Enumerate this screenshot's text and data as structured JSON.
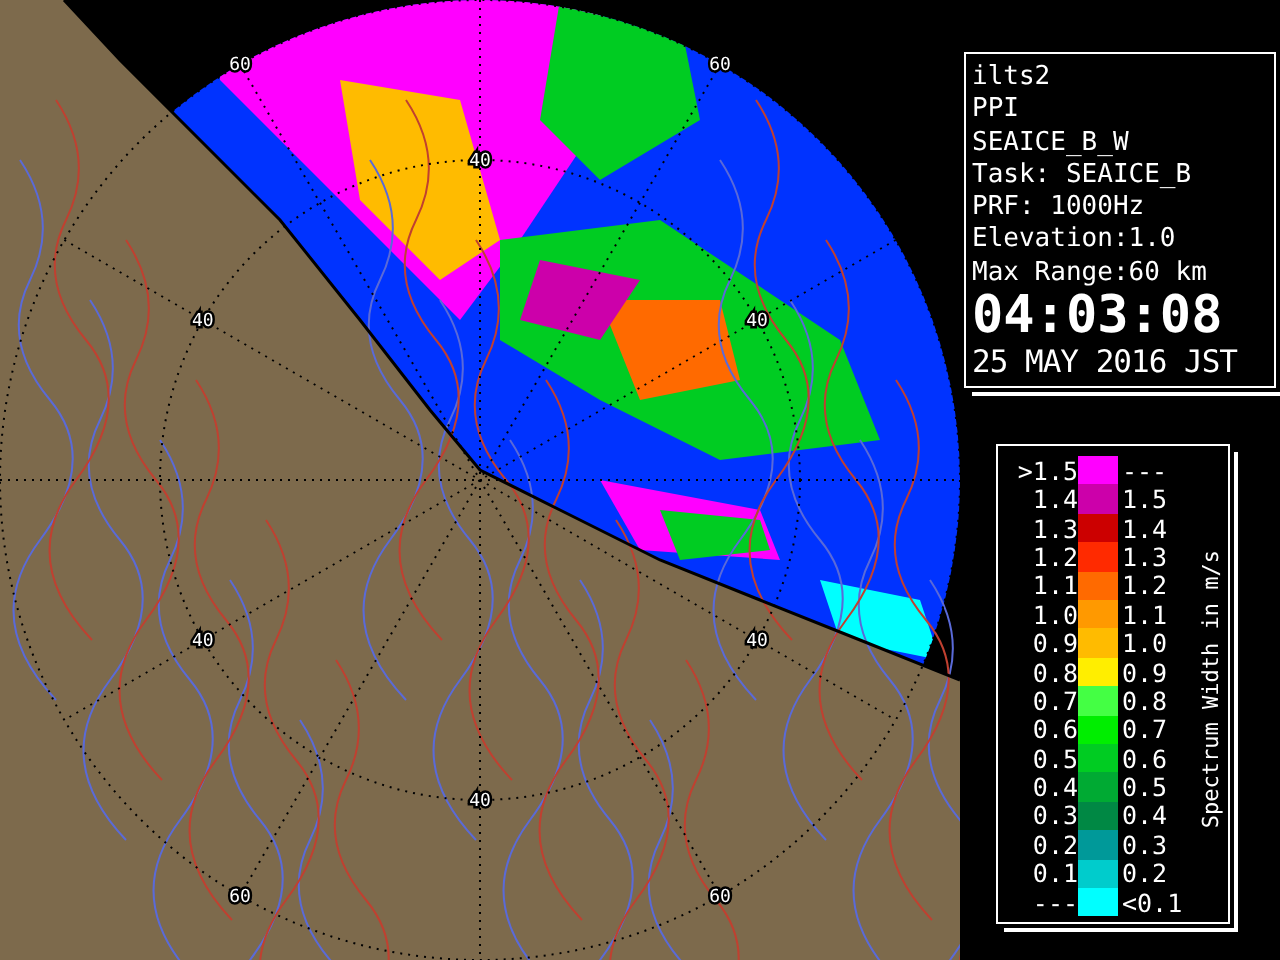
{
  "radar_map": {
    "range_rings": [
      {
        "labels": [
          "40",
          "40",
          "40",
          "40",
          "40",
          "40"
        ]
      },
      {
        "labels": [
          "60",
          "60",
          "60",
          "60"
        ]
      }
    ]
  },
  "info_panel": {
    "lines": [
      "ilts2",
      "PPI",
      "SEAICE_B_W",
      "Task: SEAICE_B",
      "PRF: 1000Hz",
      "Elevation:1.0",
      "Max Range:60 km"
    ],
    "time": "04:03:08",
    "date": "25 MAY 2016 JST"
  },
  "legend": {
    "title": "Spectrum Width in m/s",
    "rows": [
      {
        "low": ">1.5",
        "high": "---",
        "color": "#ff00ff"
      },
      {
        "low": "1.4",
        "high": "1.5",
        "color": "#cc00aa"
      },
      {
        "low": "1.3",
        "high": "1.4",
        "color": "#cc0000"
      },
      {
        "low": "1.2",
        "high": "1.3",
        "color": "#ff2a00"
      },
      {
        "low": "1.1",
        "high": "1.2",
        "color": "#ff6a00"
      },
      {
        "low": "1.0",
        "high": "1.1",
        "color": "#ff9900"
      },
      {
        "low": "0.9",
        "high": "1.0",
        "color": "#ffbb00"
      },
      {
        "low": "0.8",
        "high": "0.9",
        "color": "#ffee00"
      },
      {
        "low": "0.7",
        "high": "0.8",
        "color": "#44ff44"
      },
      {
        "low": "0.6",
        "high": "0.7",
        "color": "#00ee00"
      },
      {
        "low": "0.5",
        "high": "0.6",
        "color": "#00cc22"
      },
      {
        "low": "0.4",
        "high": "0.5",
        "color": "#00aa33"
      },
      {
        "low": "0.3",
        "high": "0.4",
        "color": "#008844"
      },
      {
        "low": "0.2",
        "high": "0.3",
        "color": "#009999"
      },
      {
        "low": "0.1",
        "high": "0.2",
        "color": "#00cccc"
      },
      {
        "low": "---",
        "high": "<0.1",
        "color": "#00ffff"
      }
    ]
  }
}
